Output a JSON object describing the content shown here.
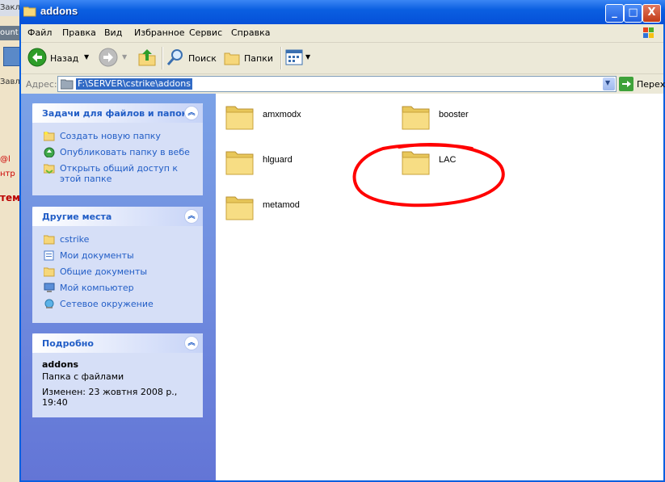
{
  "background_window": {
    "title_fragment": "Закл",
    "tab_fragment": "ount",
    "text_fragment_1": "Завле",
    "text_fragment_2": "@l",
    "text_fragment_3": "нтр",
    "text_fragment_4": "тем"
  },
  "window": {
    "title": "addons",
    "min_label": "_",
    "max_label": "□",
    "close_label": "X"
  },
  "menu": {
    "items": [
      "Файл",
      "Правка",
      "Вид",
      "Избранное",
      "Сервис",
      "Справка"
    ]
  },
  "toolbar": {
    "back_label": "Назад",
    "search_label": "Поиск",
    "folders_label": "Папки"
  },
  "address": {
    "label": "Адрес:",
    "path": "F:\\SERVER\\cstrike\\addons",
    "go_label": "Переход"
  },
  "tasks_panel": {
    "title": "Задачи для файлов и папок",
    "links": [
      {
        "label": "Создать новую папку",
        "icon": "new-folder-icon"
      },
      {
        "label": "Опубликовать папку в вебе",
        "icon": "publish-web-icon"
      },
      {
        "label": "Открыть общий доступ к этой папке",
        "icon": "share-folder-icon"
      }
    ]
  },
  "places_panel": {
    "title": "Другие места",
    "links": [
      {
        "label": "cstrike",
        "icon": "folder-icon"
      },
      {
        "label": "Мои документы",
        "icon": "my-documents-icon"
      },
      {
        "label": "Общие документы",
        "icon": "shared-documents-icon"
      },
      {
        "label": "Мой компьютер",
        "icon": "my-computer-icon"
      },
      {
        "label": "Сетевое окружение",
        "icon": "network-icon"
      }
    ]
  },
  "details_panel": {
    "title": "Подробно",
    "name": "addons",
    "type": "Папка с файлами",
    "modified": "Изменен: 23 жовтня 2008 р., 19:40"
  },
  "folders": [
    {
      "name": "amxmodx"
    },
    {
      "name": "booster"
    },
    {
      "name": "hlguard"
    },
    {
      "name": "LAC"
    },
    {
      "name": "metamod"
    }
  ],
  "colors": {
    "title_bar": "#0b5fe1",
    "side_pane": "#7ba2e7",
    "link": "#215dc6",
    "scribble": "#ff0000"
  }
}
